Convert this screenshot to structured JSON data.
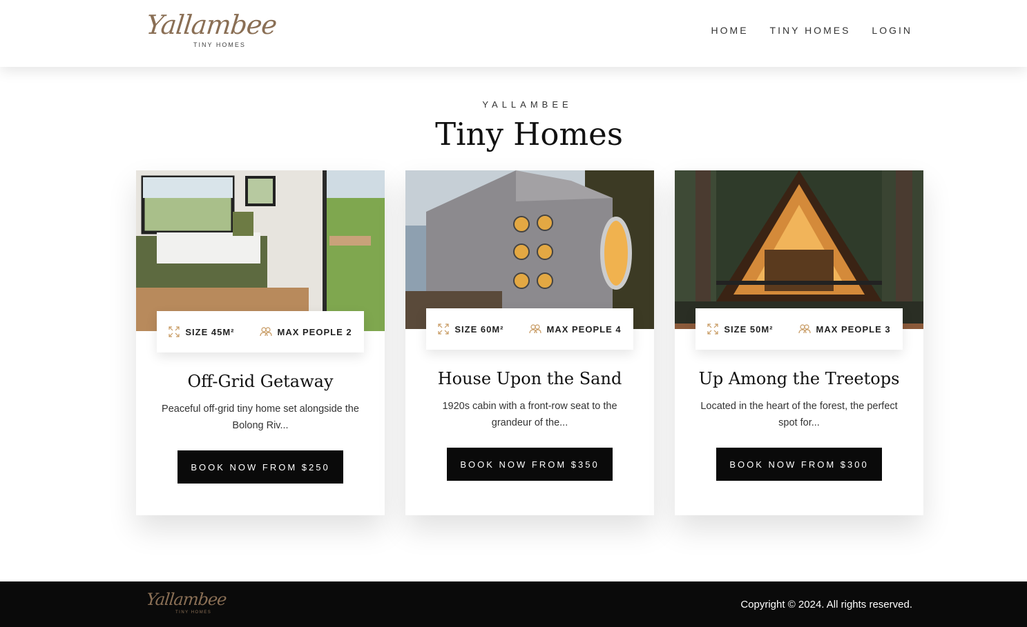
{
  "header": {
    "logo_script": "Yallambee",
    "logo_sub": "TINY HOMES",
    "nav": [
      "HOME",
      "TINY HOMES",
      "LOGIN"
    ]
  },
  "hero": {
    "eyebrow": "YALLAMBEE",
    "title": "Tiny Homes"
  },
  "cards": [
    {
      "size": "SIZE 45M²",
      "max_people": "MAX PEOPLE 2",
      "title": "Off-Grid Getaway",
      "description": "Peaceful off-grid tiny home set alongside the Bolong Riv...",
      "button": "BOOK NOW FROM $250"
    },
    {
      "size": "SIZE 60M²",
      "max_people": "MAX PEOPLE 4",
      "title": "House Upon the Sand",
      "description": "1920s cabin with a front-row seat to the grandeur of the...",
      "button": "BOOK NOW FROM $350"
    },
    {
      "size": "SIZE 50M²",
      "max_people": "MAX PEOPLE 3",
      "title": "Up Among the Treetops",
      "description": "Located in the heart of the forest, the perfect spot for...",
      "button": "BOOK NOW FROM $300"
    }
  ],
  "footer": {
    "logo_script": "Yallambee",
    "logo_sub": "TINY HOMES",
    "copyright": "Copyright © 2024. All rights reserved."
  },
  "colors": {
    "brand": "#8a6f55",
    "icon_accent": "#c79a62",
    "button_bg": "#0a0a0a",
    "footer_bg": "#0a0a0a"
  }
}
